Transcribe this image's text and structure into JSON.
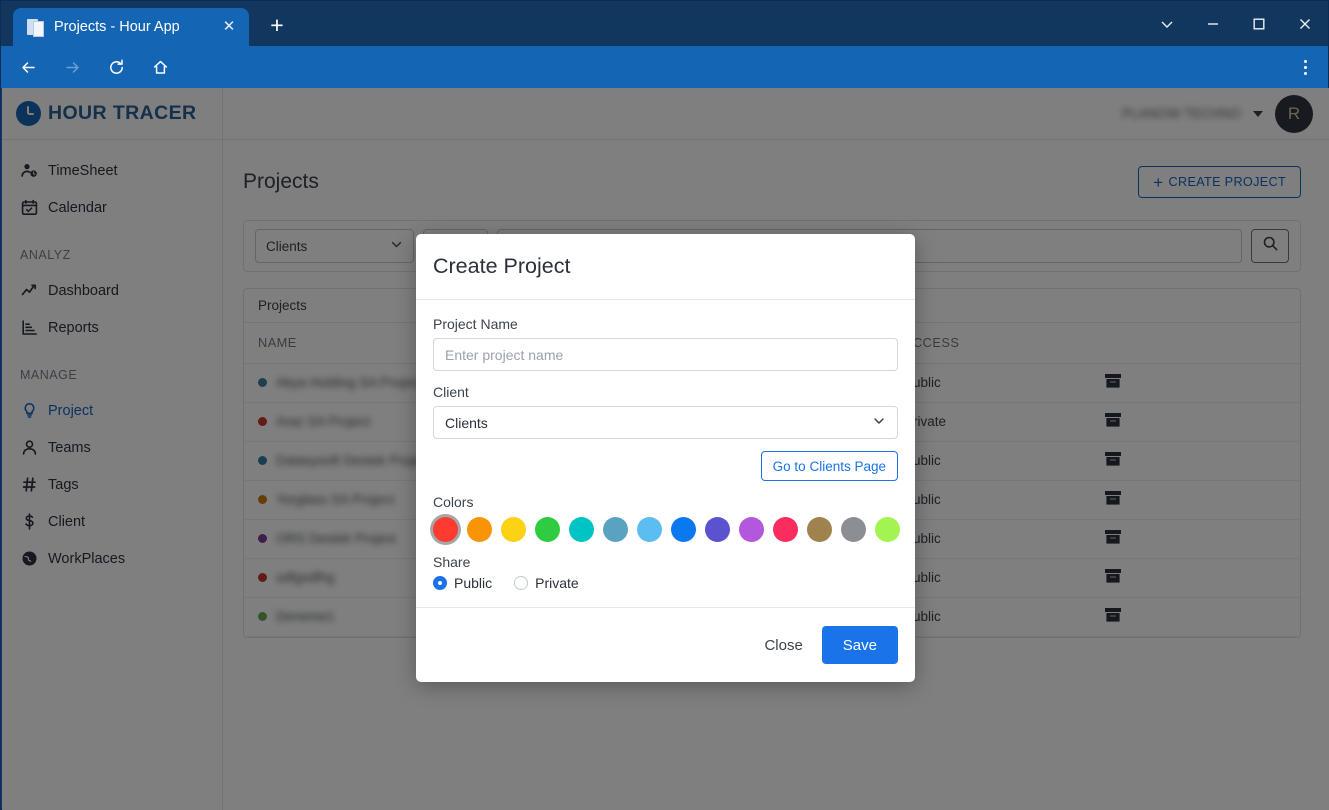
{
  "browser": {
    "tab_title": "Projects - Hour App",
    "favicon": "document-icon",
    "close_tab_label": "✕",
    "new_tab_label": "+",
    "nav": {
      "back": "back-arrow-icon",
      "forward": "forward-arrow-icon",
      "reload": "reload-icon",
      "home": "home-icon"
    },
    "window_controls": [
      "chevron-down-icon",
      "minimize-icon",
      "maximize-icon",
      "close-icon"
    ],
    "menu": "vertical-dots-icon"
  },
  "app": {
    "brand_name": "HOUR TRACER",
    "org_name": "PLANOW TECHNO",
    "avatar_initial": "R"
  },
  "sidebar": {
    "items": [
      {
        "label": "TimeSheet",
        "icon": "user-clock-icon",
        "type": "link",
        "active": false
      },
      {
        "label": "Calendar",
        "icon": "calendar-icon",
        "type": "link",
        "active": false
      },
      {
        "label": "ANALYZ",
        "type": "section"
      },
      {
        "label": "Dashboard",
        "icon": "chart-line-icon",
        "type": "link",
        "active": false
      },
      {
        "label": "Reports",
        "icon": "chart-bar-icon",
        "type": "link",
        "active": false
      },
      {
        "label": "MANAGE",
        "type": "section"
      },
      {
        "label": "Project",
        "icon": "lightbulb-icon",
        "type": "link",
        "active": true
      },
      {
        "label": "Teams",
        "icon": "user-icon",
        "type": "link",
        "active": false
      },
      {
        "label": "Tags",
        "icon": "hash-icon",
        "type": "link",
        "active": false
      },
      {
        "label": "Client",
        "icon": "dollar-icon",
        "type": "link",
        "active": false
      },
      {
        "label": "WorkPlaces",
        "icon": "globe-icon",
        "type": "link",
        "active": false
      }
    ]
  },
  "main": {
    "page_title": "Projects",
    "create_project_label": "CREATE PROJECT",
    "create_project_plus": "+",
    "filters": {
      "clients_value": "Clients",
      "secondary_value": "",
      "search_value": "",
      "search_placeholder": "",
      "search_icon": "search-icon"
    },
    "card_title": "Projects",
    "table": {
      "columns": [
        "NAME",
        "ACCESS",
        ""
      ],
      "rows": [
        {
          "name": "Akya Holding SA Project",
          "dot": "#3d7f96",
          "access": "Public",
          "action": "archive-icon"
        },
        {
          "name": "Araz SA Project",
          "dot": "#c0392b",
          "access": "Private",
          "action": "archive-icon"
        },
        {
          "name": "Datasysoft Destek Projesi",
          "dot": "#2f7f9e",
          "access": "Public",
          "action": "archive-icon"
        },
        {
          "name": "Yorglass SA Project",
          "dot": "#c87f0a",
          "access": "Public",
          "action": "archive-icon"
        },
        {
          "name": "ORS Destek Projesi",
          "dot": "#7d3c98",
          "access": "Public",
          "action": "archive-icon"
        },
        {
          "name": "sdfgsdfhg",
          "dot": "#c0392b",
          "access": "Public",
          "action": "archive-icon"
        },
        {
          "name": "Deneme1",
          "dot": "#6aa84f",
          "access": "Public",
          "action": "archive-icon"
        }
      ]
    }
  },
  "modal": {
    "title": "Create Project",
    "project_name_label": "Project Name",
    "project_name_value": "",
    "project_name_placeholder": "Enter project name",
    "client_label": "Client",
    "client_value": "Clients",
    "client_caret": "chevron-down-icon",
    "go_to_clients_label": "Go to Clients Page",
    "colors_label": "Colors",
    "colors": [
      "#ff3b30",
      "#f89406",
      "#fcd116",
      "#2ecc40",
      "#00c4c4",
      "#5aa3c0",
      "#5bbdf0",
      "#0a79f0",
      "#5b52cf",
      "#b357dd",
      "#fa2d5e",
      "#a0824f",
      "#8b8f94",
      "#a3f451"
    ],
    "selected_color_index": 0,
    "share_label": "Share",
    "share_options": [
      {
        "label": "Public",
        "checked": true
      },
      {
        "label": "Private",
        "checked": false
      }
    ],
    "close_label": "Close",
    "save_label": "Save"
  }
}
